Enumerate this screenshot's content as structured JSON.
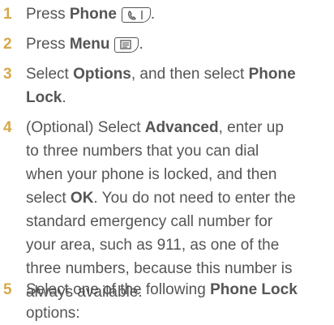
{
  "steps": [
    {
      "num": "1",
      "pre": "Press ",
      "b1": "Phone",
      "post": "."
    },
    {
      "num": "2",
      "pre": "Press ",
      "b1": "Menu",
      "post": "."
    },
    {
      "lines": [
        {
          "t1": "Select ",
          "b1": "Options",
          "t2": ", and then select ",
          "b2": "Phone"
        },
        {
          "b1": "Lock",
          "t2": "."
        }
      ],
      "num": "3"
    },
    {
      "num": "4",
      "lines": [
        {
          "t1": "(Optional)  Select ",
          "b1": "Advanced",
          "t2": ", enter up"
        },
        {
          "t1": "to three numbers that you can dial"
        },
        {
          "t1": "when your phone is locked, and then"
        },
        {
          "t1": "select ",
          "b1": "OK",
          "t2": ". You do not need to enter the"
        },
        {
          "t1": "standard emergency call number for"
        },
        {
          "t1": "your area, such as 911, as one of the"
        },
        {
          "t1": "three numbers, because this number is"
        },
        {
          "t1": "always available."
        }
      ]
    },
    {
      "num": "5",
      "lines": [
        {
          "t1": "Select one of the following ",
          "b1": "Phone Lock"
        },
        {
          "t1": "options:"
        }
      ]
    }
  ],
  "icons": {
    "phone_key": "phone-handset-icon",
    "menu_key": "menu-icon"
  },
  "colors": {
    "step_number": "#d6a84a",
    "text": "#555555"
  }
}
